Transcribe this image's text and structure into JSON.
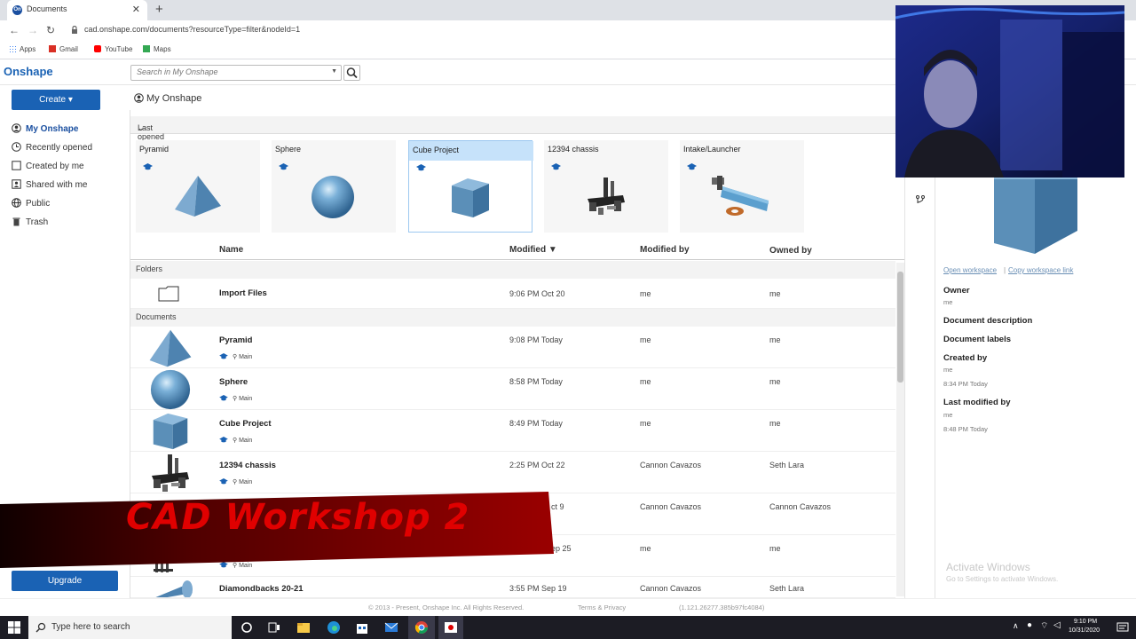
{
  "browser": {
    "tab_title": "Documents",
    "tab_close": "✕",
    "new_tab": "+",
    "url": "cad.onshape.com/documents?resourceType=filter&nodeId=1",
    "bookmarks": [
      "Apps",
      "Gmail",
      "YouTube",
      "Maps"
    ]
  },
  "header": {
    "logo": "Onshape",
    "search_placeholder": "Search in My Onshape"
  },
  "sidebar": {
    "create_label": "Create ▾",
    "items": [
      {
        "label": "My Onshape"
      },
      {
        "label": "Recently opened"
      },
      {
        "label": "Created by me"
      },
      {
        "label": "Shared with me"
      },
      {
        "label": "Public"
      },
      {
        "label": "Trash"
      }
    ],
    "upgrade_label": "Upgrade"
  },
  "main": {
    "breadcrumb": "My Onshape",
    "recent_header": "Last opened by me",
    "recent_cards": [
      {
        "title": "Pyramid"
      },
      {
        "title": "Sphere"
      },
      {
        "title": "Cube Project"
      },
      {
        "title": "12394 chassis"
      },
      {
        "title": "Intake/Launcher"
      }
    ],
    "columns": {
      "name": "Name",
      "modified": "Modified ▼",
      "modified_by": "Modified by",
      "owned_by": "Owned by"
    },
    "folders_label": "Folders",
    "documents_label": "Documents",
    "folders": [
      {
        "name": "Import Files",
        "modified": "9:06 PM Oct 20",
        "modified_by": "me",
        "owned_by": "me"
      }
    ],
    "documents": [
      {
        "name": "Pyramid",
        "branch": "Main",
        "modified": "9:08 PM Today",
        "modified_by": "me",
        "owned_by": "me"
      },
      {
        "name": "Sphere",
        "branch": "Main",
        "modified": "8:58 PM Today",
        "modified_by": "me",
        "owned_by": "me"
      },
      {
        "name": "Cube Project",
        "branch": "Main",
        "modified": "8:49 PM Today",
        "modified_by": "me",
        "owned_by": "me"
      },
      {
        "name": "12394 chassis",
        "branch": "Main",
        "modified": "2:25 PM Oct 22",
        "modified_by": "Cannon Cavazos",
        "owned_by": "Seth Lara"
      },
      {
        "name": "",
        "branch": "",
        "modified": "ct 9",
        "modified_by": "Cannon Cavazos",
        "owned_by": "Cannon Cavazos"
      },
      {
        "name": "",
        "branch": "Main",
        "modified": "ep 25",
        "modified_by": "me",
        "owned_by": "me"
      },
      {
        "name": "Diamondbacks 20-21",
        "branch": "",
        "modified": "3:55 PM Sep 19",
        "modified_by": "Cannon Cavazos",
        "owned_by": "Seth Lara"
      }
    ]
  },
  "details": {
    "open_workspace": "Open workspace",
    "separator": "|",
    "copy_link": "Copy workspace link",
    "owner_label": "Owner",
    "owner": "me",
    "description_label": "Document description",
    "labels_label": "Document labels",
    "created_by_label": "Created by",
    "created_by": "me",
    "created_at": "8:34 PM Today",
    "last_modified_label": "Last modified by",
    "last_modified_by": "me",
    "last_modified_at": "8:48 PM Today"
  },
  "footer": {
    "copyright": "© 2013 - Present, Onshape Inc. All Rights Reserved.",
    "terms": "Terms & Privacy",
    "version": "(1.121.26277.385b97fc4084)"
  },
  "overlay": {
    "banner": "CAD Workshop 2",
    "activate_title": "Activate Windows",
    "activate_sub": "Go to Settings to activate Windows."
  },
  "taskbar": {
    "search_placeholder": "Type here to search",
    "time": "9:10 PM",
    "date": "10/31/2020"
  },
  "colors": {
    "accent": "#1a62b4",
    "model": "#5b8fb8",
    "banner_red": "#e00000"
  }
}
